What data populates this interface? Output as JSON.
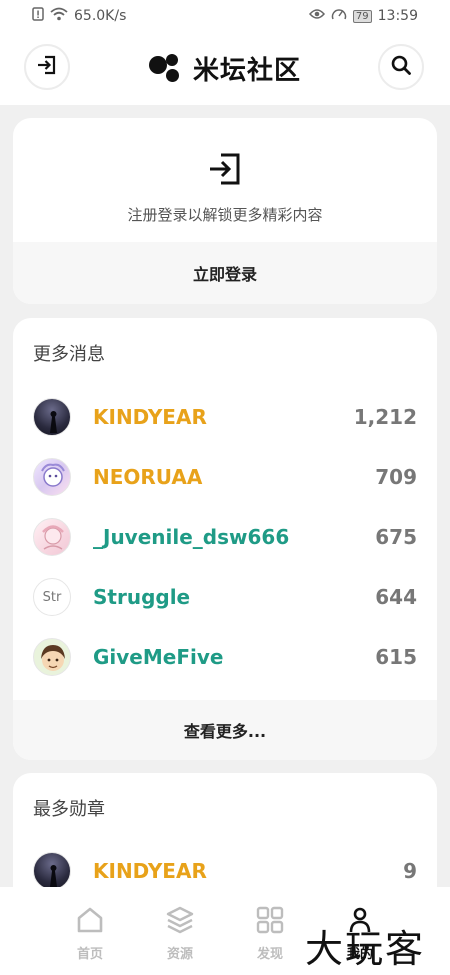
{
  "status_bar": {
    "net_speed": "65.0K/s",
    "battery": "79",
    "time": "13:59"
  },
  "header": {
    "title": "米坛社区",
    "login_icon": "login-icon",
    "search_icon": "search-icon"
  },
  "login_card": {
    "hint": "注册登录以解锁更多精彩内容",
    "button_label": "立即登录"
  },
  "news_card": {
    "title": "更多消息",
    "items": [
      {
        "name": "KINDYEAR",
        "value": "1,212",
        "color": "#e8a21a"
      },
      {
        "name": "NEORUAA",
        "value": "709",
        "color": "#e8a21a"
      },
      {
        "name": "_Juvenile_dsw666",
        "value": "675",
        "color": "#1f9b86"
      },
      {
        "name": "Struggle",
        "value": "644",
        "color": "#1f9b86"
      },
      {
        "name": "GiveMeFive",
        "value": "615",
        "color": "#1f9b86"
      }
    ],
    "more_label": "查看更多..."
  },
  "medal_card": {
    "title": "最多勋章",
    "items": [
      {
        "name": "KINDYEAR",
        "value": "9",
        "color": "#e8a21a"
      }
    ]
  },
  "bottom_nav": {
    "items": [
      {
        "label": "首页",
        "icon": "home-icon"
      },
      {
        "label": "资源",
        "icon": "layers-icon"
      },
      {
        "label": "发现",
        "icon": "grid-icon"
      },
      {
        "label": "我的",
        "icon": "person-icon"
      }
    ]
  },
  "watermark": "大玩客"
}
